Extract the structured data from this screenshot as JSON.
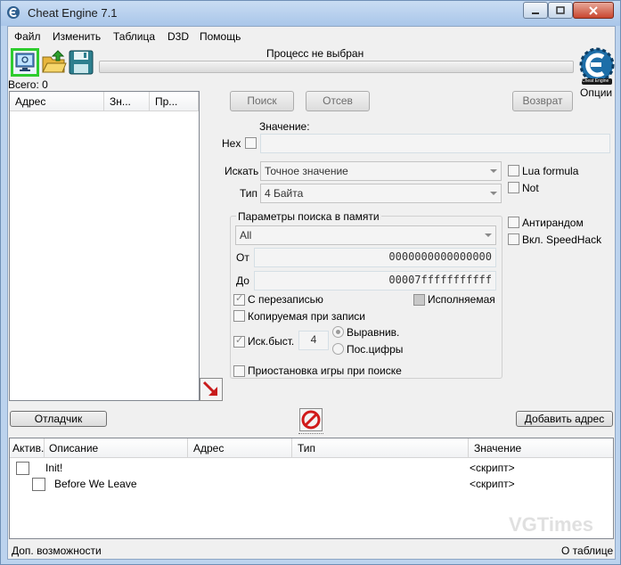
{
  "window": {
    "title": "Cheat Engine 7.1"
  },
  "menu": [
    "Файл",
    "Изменить",
    "Таблица",
    "D3D",
    "Помощь"
  ],
  "process": {
    "label": "Процесс не выбран"
  },
  "found": {
    "label": "Всего: 0"
  },
  "results_table": {
    "columns": [
      "Адрес",
      "Зн...",
      "Пр..."
    ]
  },
  "buttons": {
    "first_scan": "Поиск",
    "next_scan": "Отсев",
    "undo_scan": "Возврат",
    "debugger": "Отладчик",
    "add_address": "Добавить адрес"
  },
  "logo": {
    "text": "Cheat Engine",
    "settings": "Опции"
  },
  "value": {
    "label": "Значение:",
    "hex_label": "Hex",
    "text": ""
  },
  "scan_type": {
    "label": "Искать",
    "value": "Точное значение"
  },
  "value_type": {
    "label": "Тип",
    "value": "4 Байта"
  },
  "options_right": {
    "lua": "Lua formula",
    "not": "Not",
    "unrandomizer": "Антирандом",
    "speedhack": "Вкл. SpeedHack"
  },
  "memory_scan": {
    "title": "Параметры поиска в памяти",
    "region": "All",
    "from_label": "От",
    "from": "0000000000000000",
    "to_label": "До",
    "to": "00007fffffffffff",
    "writable": "С перезаписью",
    "executable": "Исполняемая",
    "copy_on_write": "Копируемая при записи",
    "fast_scan": "Иск.быст.",
    "fast_scan_value": "4",
    "alignment": "Выравнив.",
    "last_digits": "Пос.цифры",
    "pause": "Приостановка игры при поиске"
  },
  "address_list": {
    "columns": [
      "Актив.",
      "Описание",
      "Адрес",
      "Тип",
      "Значение"
    ],
    "rows": [
      {
        "description": "Init!",
        "value": "<скрипт>"
      },
      {
        "description": "Before We Leave",
        "value": "<скрипт>"
      }
    ]
  },
  "watermark": "VGTimes",
  "status": {
    "left": "Доп. возможности",
    "right": "О таблице"
  },
  "colors": {
    "titlebar": "#bcd3ee",
    "highlight": "#2ecc2e",
    "accent_red": "#d11a1a"
  }
}
